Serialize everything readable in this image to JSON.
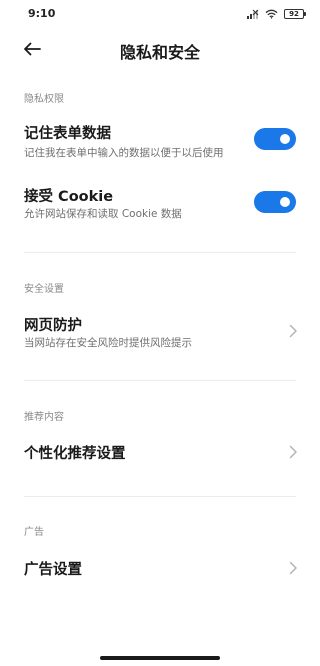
{
  "status_bar": {
    "time": "9:10",
    "battery": "92"
  },
  "header": {
    "title": "隐私和安全"
  },
  "privacy": {
    "section_title": "隐私权限",
    "remember_form": {
      "title": "记住表单数据",
      "subtitle": "记住我在表单中输入的数据以便于以后使用",
      "enabled": true
    },
    "accept_cookie": {
      "title": "接受 Cookie",
      "subtitle": "允许网站保存和读取 Cookie 数据",
      "enabled": true
    }
  },
  "security": {
    "section_title": "安全设置",
    "web_protection": {
      "title": "网页防护",
      "subtitle": "当网站存在安全风险时提供风险提示"
    }
  },
  "recommend": {
    "section_title": "推荐内容",
    "personalized": {
      "title": "个性化推荐设置"
    }
  },
  "ads": {
    "section_title": "广告",
    "ad_settings": {
      "title": "广告设置"
    }
  },
  "colors": {
    "accent": "#1b78e8",
    "section_header": "#8a8a8a"
  }
}
